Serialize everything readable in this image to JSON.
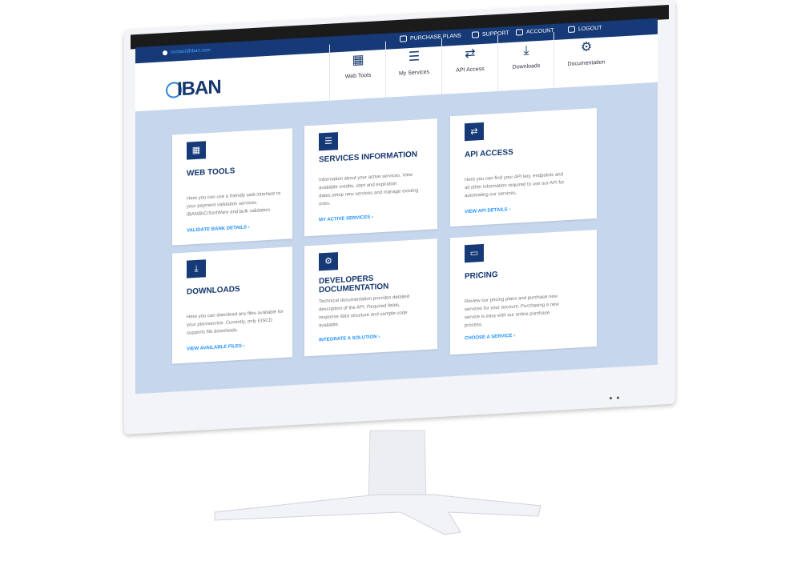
{
  "topbar": {
    "links": [
      {
        "label": "PURCHASE PLANS",
        "icon": "card-icon"
      },
      {
        "label": "SUPPORT",
        "icon": "chat-icon"
      },
      {
        "label": "ACCOUNT",
        "icon": "gear-icon"
      },
      {
        "label": "LOGOUT",
        "icon": "power-icon"
      }
    ],
    "email": "contact@iban.com"
  },
  "logo": "IBAN",
  "nav": [
    {
      "label": "Web Tools",
      "glyph": "▦"
    },
    {
      "label": "My Services",
      "glyph": "☰"
    },
    {
      "label": "API Access",
      "glyph": "⇄"
    },
    {
      "label": "Downloads",
      "glyph": "⤓"
    },
    {
      "label": "Documentation",
      "glyph": "⚙"
    }
  ],
  "cards": [
    {
      "title": "WEB TOOLS",
      "glyph": "▦",
      "desc": "Here you can use a friendly web interface to your payment validation services. IBAN/BIC/SortWare and bulk validation.",
      "link": "VALIDATE BANK DETAILS  ›"
    },
    {
      "title": "SERVICES INFORMATION",
      "glyph": "☰",
      "desc": "Information about your active services. View available credits, start and expiration dates,setup new services and manage existing ones.",
      "link": "MY ACTIVE SERVICES  ›"
    },
    {
      "title": "API ACCESS",
      "glyph": "⇄",
      "desc": "Here you can find your API key, endpoints and all other information required to use our API for automating our services.",
      "link": "VIEW API DETAILS  ›"
    },
    {
      "title": "DOWNLOADS",
      "glyph": "⤓",
      "desc": "Here you can download any files available for your plan/service. Currently, only EISCD supports file downloads.",
      "link": "VIEW AVAILABLE FILES  ›"
    },
    {
      "title": "DEVELOPERS DOCUMENTATION",
      "glyph": "⚙",
      "desc": "Technical documentation provides detailed description of the API. Required fields, response data structure and sample code available.",
      "link": "INTEGRATE A SOLUTION  ›"
    },
    {
      "title": "PRICING",
      "glyph": "▭",
      "desc": "Review our pricing plans and purchase new services for your account. Purchasing a new service is easy with our online purchase process.",
      "link": "CHOOSE A SERVICE  ›"
    }
  ],
  "colors": {
    "brand": "#163a78",
    "link": "#1e90ff",
    "background": "#c6d6ec"
  }
}
